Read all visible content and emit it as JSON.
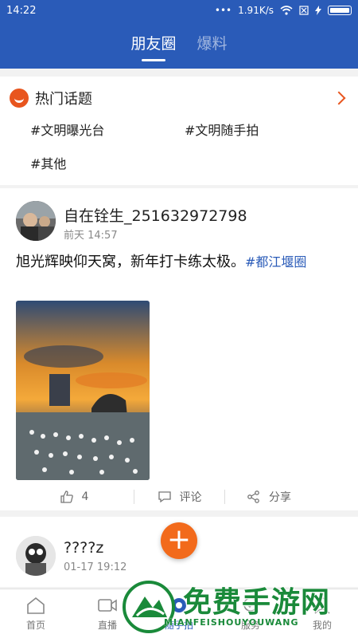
{
  "status": {
    "time": "14:22",
    "dots": "•••",
    "speed": "1.91K/s"
  },
  "header": {
    "tabs": [
      {
        "label": "朋友圈"
      },
      {
        "label": "爆料"
      }
    ]
  },
  "hot_topics": {
    "title": "热门话题",
    "items": [
      {
        "label": "#文明曝光台"
      },
      {
        "label": "#文明随手拍"
      },
      {
        "label": "#其他"
      }
    ]
  },
  "post1": {
    "username": "自在铨生_251632972798",
    "time": "前天 14:57",
    "text": "旭光辉映仰天窝，新年打卡练太极。",
    "hashtag": "#都江堰圈",
    "likes": "4",
    "comment_label": "评论",
    "share_label": "分享"
  },
  "post2": {
    "username": "????z",
    "time": "01-17 19:12"
  },
  "fab": {
    "label": "+"
  },
  "bottom_nav": {
    "items": [
      {
        "label": "首页"
      },
      {
        "label": "直播"
      },
      {
        "label": "随手拍"
      },
      {
        "label": "服务"
      },
      {
        "label": "我的"
      }
    ],
    "accent": "#2a5bb8"
  },
  "watermark": {
    "title": "免费手游网",
    "subtitle": "MIANFEISHOUYOUWANG"
  },
  "colors": {
    "header": "#2a5bb8",
    "accent_orange": "#f26a1b",
    "hashtag": "#2a5bb8"
  }
}
